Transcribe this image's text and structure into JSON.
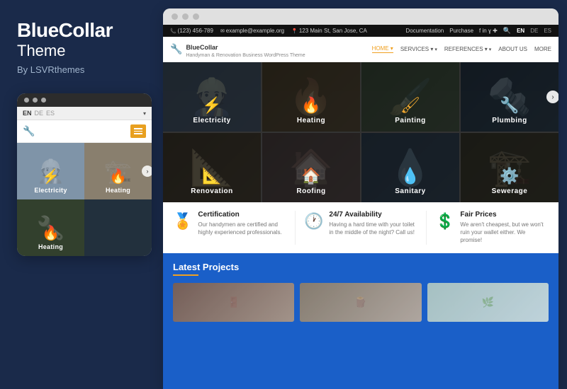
{
  "left": {
    "brand": "BlueCollar",
    "theme": "Theme",
    "by": "By LSVRthemes"
  },
  "mobile": {
    "lang": {
      "active": "EN",
      "options": [
        "DE",
        "ES"
      ]
    },
    "services": [
      {
        "id": "electricity",
        "label": "Electricity",
        "icon": "⚡"
      },
      {
        "id": "heating",
        "label": "Heating",
        "icon": "🔥"
      }
    ],
    "arrow": "›"
  },
  "desktop": {
    "topbar": {
      "phone": "(123) 456-789",
      "email": "example@example.org",
      "location": "123 Main St, San Jose, CA",
      "links": [
        "Documentation",
        "Purchase"
      ],
      "langs": [
        "EN",
        "DE",
        "ES"
      ]
    },
    "nav": {
      "brand": "BlueCollar",
      "tagline": "Handyman & Renovation Business WordPress Theme",
      "items": [
        {
          "label": "HOME",
          "active": true,
          "hasArrow": false
        },
        {
          "label": "SERVICES",
          "active": false,
          "hasArrow": true
        },
        {
          "label": "REFERENCES",
          "active": false,
          "hasArrow": true
        },
        {
          "label": "ABOUT US",
          "active": false,
          "hasArrow": false
        },
        {
          "label": "MORE",
          "active": false,
          "hasArrow": false
        }
      ]
    },
    "services": [
      {
        "id": "electricity",
        "label": "Electricity",
        "icon": "⚡"
      },
      {
        "id": "heating",
        "label": "Heating",
        "icon": "🔥"
      },
      {
        "id": "painting",
        "label": "Painting",
        "icon": "🖌"
      },
      {
        "id": "plumbing",
        "label": "Plumbing",
        "icon": "🔧"
      },
      {
        "id": "renovation",
        "label": "Renovation",
        "icon": "📐"
      },
      {
        "id": "roofing",
        "label": "Roofing",
        "icon": "🏠"
      },
      {
        "id": "sanitary",
        "label": "Sanitary",
        "icon": "💧"
      },
      {
        "id": "sewerage",
        "label": "Sewerage",
        "icon": "🔩"
      }
    ],
    "features": [
      {
        "id": "certification",
        "icon": "🏅",
        "title": "Certification",
        "desc": "Our handymen are certified and highly experienced professionals."
      },
      {
        "id": "availability",
        "icon": "🕐",
        "title": "24/7 Availability",
        "desc": "Having a hard time with your toilet in the middle of the night? Call us!"
      },
      {
        "id": "fairprices",
        "icon": "💲",
        "title": "Fair Prices",
        "desc": "We aren't cheapest, but we won't ruin your wallet either. We promise!"
      }
    ],
    "projects": {
      "title": "Latest Projects",
      "items": [
        "project1",
        "project2",
        "project3"
      ]
    }
  }
}
